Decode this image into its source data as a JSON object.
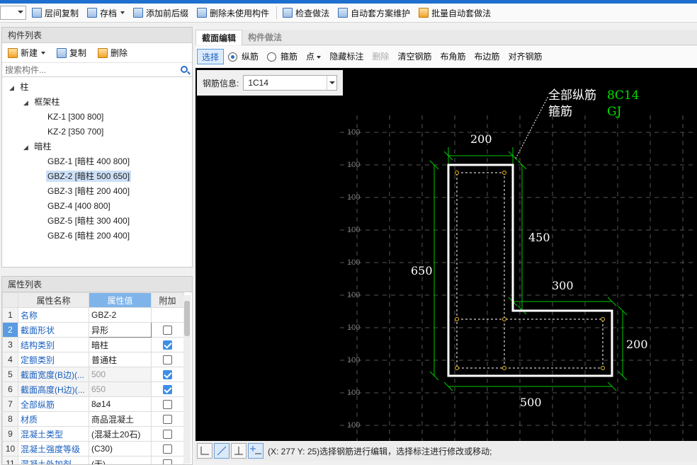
{
  "toolbar": {
    "items": [
      "层间复制",
      "存档",
      "添加前后缀",
      "删除未使用构件",
      "检查做法",
      "自动套方案维护",
      "批量自动套做法"
    ]
  },
  "component_list": {
    "title": "构件列表",
    "new_label": "新建",
    "copy_label": "复制",
    "delete_label": "删除",
    "search_placeholder": "搜索构件...",
    "tree": {
      "root": "柱",
      "group1": "框架柱",
      "group1_items": [
        "KZ-1 [300 800]",
        "KZ-2 [350 700]"
      ],
      "group2": "暗柱",
      "group2_items": [
        "GBZ-1 [暗柱 400 800]",
        "GBZ-2 [暗柱 500 650]",
        "GBZ-3 [暗柱 200 400]",
        "GBZ-4 [400 800]",
        "GBZ-5 [暗柱 300 400]",
        "GBZ-6 [暗柱 200 400]"
      ],
      "selected": "GBZ-2 [暗柱 500 650]"
    }
  },
  "properties": {
    "title": "属性列表",
    "headers": [
      "属性名称",
      "属性值",
      "附加"
    ],
    "rows": [
      {
        "n": "1",
        "name": "名称",
        "value": "GBZ-2",
        "check": null
      },
      {
        "n": "2",
        "name": "截面形状",
        "value": "异形",
        "check": false
      },
      {
        "n": "3",
        "name": "结构类别",
        "value": "暗柱",
        "check": true
      },
      {
        "n": "4",
        "name": "定额类别",
        "value": "普通柱",
        "check": false
      },
      {
        "n": "5",
        "name": "截面宽度(B边)(...",
        "value": "500",
        "check": true
      },
      {
        "n": "6",
        "name": "截面高度(H边)(...",
        "value": "650",
        "check": true
      },
      {
        "n": "7",
        "name": "全部纵筋",
        "value": "8⌀14",
        "check": false
      },
      {
        "n": "8",
        "name": "材质",
        "value": "商品混凝土",
        "check": false
      },
      {
        "n": "9",
        "name": "混凝土类型",
        "value": "(混凝土20石)",
        "check": false
      },
      {
        "n": "10",
        "name": "混凝土强度等级",
        "value": "(C30)",
        "check": false
      },
      {
        "n": "11",
        "name": "混凝土外加剂",
        "value": "(无)",
        "check": false
      }
    ]
  },
  "editor": {
    "tabs": [
      "截面编辑",
      "构件做法"
    ],
    "tools": {
      "select": "选择",
      "longitudinal": "纵筋",
      "stirrup": "箍筋",
      "point": "点",
      "hide_label": "隐藏标注",
      "delete": "删除",
      "clear": "清空钢筋",
      "corner": "布角筋",
      "edge": "布边筋",
      "symmetric": "对齐钢筋"
    },
    "rebar_info_label": "钢筋信息:",
    "rebar_info_value": "1C14"
  },
  "drawing": {
    "grid_labels": [
      "100",
      "100",
      "100",
      "100",
      "100",
      "100",
      "100",
      "100",
      "100",
      "100",
      "100"
    ],
    "note_line1_label": "全部纵筋",
    "note_line1_value": "8C14",
    "note_line2_label": "箍筋",
    "note_line2_value": "GJ",
    "dim_top": "200",
    "dim_inner_right": "450",
    "dim_step": "300",
    "dim_left": "650",
    "dim_right": "200",
    "dim_bottom": "500",
    "colors": {
      "outline": "#ffffff",
      "dim": "#00c800",
      "note_value": "#00e000",
      "grid": "#555555",
      "rebar": "#f0c020"
    }
  },
  "status": {
    "message": "(X: 277 Y: 25)选择钢筋进行编辑，选择标注进行修改或移动;"
  }
}
